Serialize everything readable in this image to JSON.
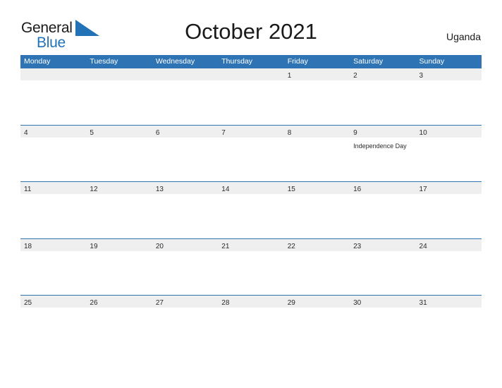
{
  "brand": {
    "name_part1": "General",
    "name_part2": "Blue",
    "flag_icon": "blue-triangle-flag-icon",
    "color_dark": "#1a1a1a",
    "color_blue": "#2272b8"
  },
  "header": {
    "title": "October 2021",
    "region": "Uganda"
  },
  "theme": {
    "header_blue": "#2e74b5",
    "band_gray": "#efefef",
    "text_dark": "#2b2b2b",
    "page_bg": "#ffffff"
  },
  "calendar": {
    "month": "October",
    "year": "2021",
    "weekdays": [
      "Monday",
      "Tuesday",
      "Wednesday",
      "Thursday",
      "Friday",
      "Saturday",
      "Sunday"
    ],
    "weeks": [
      [
        {
          "day": "",
          "event": ""
        },
        {
          "day": "",
          "event": ""
        },
        {
          "day": "",
          "event": ""
        },
        {
          "day": "",
          "event": ""
        },
        {
          "day": "1",
          "event": ""
        },
        {
          "day": "2",
          "event": ""
        },
        {
          "day": "3",
          "event": ""
        }
      ],
      [
        {
          "day": "4",
          "event": ""
        },
        {
          "day": "5",
          "event": ""
        },
        {
          "day": "6",
          "event": ""
        },
        {
          "day": "7",
          "event": ""
        },
        {
          "day": "8",
          "event": ""
        },
        {
          "day": "9",
          "event": "Independence Day"
        },
        {
          "day": "10",
          "event": ""
        }
      ],
      [
        {
          "day": "11",
          "event": ""
        },
        {
          "day": "12",
          "event": ""
        },
        {
          "day": "13",
          "event": ""
        },
        {
          "day": "14",
          "event": ""
        },
        {
          "day": "15",
          "event": ""
        },
        {
          "day": "16",
          "event": ""
        },
        {
          "day": "17",
          "event": ""
        }
      ],
      [
        {
          "day": "18",
          "event": ""
        },
        {
          "day": "19",
          "event": ""
        },
        {
          "day": "20",
          "event": ""
        },
        {
          "day": "21",
          "event": ""
        },
        {
          "day": "22",
          "event": ""
        },
        {
          "day": "23",
          "event": ""
        },
        {
          "day": "24",
          "event": ""
        }
      ],
      [
        {
          "day": "25",
          "event": ""
        },
        {
          "day": "26",
          "event": ""
        },
        {
          "day": "27",
          "event": ""
        },
        {
          "day": "28",
          "event": ""
        },
        {
          "day": "29",
          "event": ""
        },
        {
          "day": "30",
          "event": ""
        },
        {
          "day": "31",
          "event": ""
        }
      ]
    ]
  }
}
